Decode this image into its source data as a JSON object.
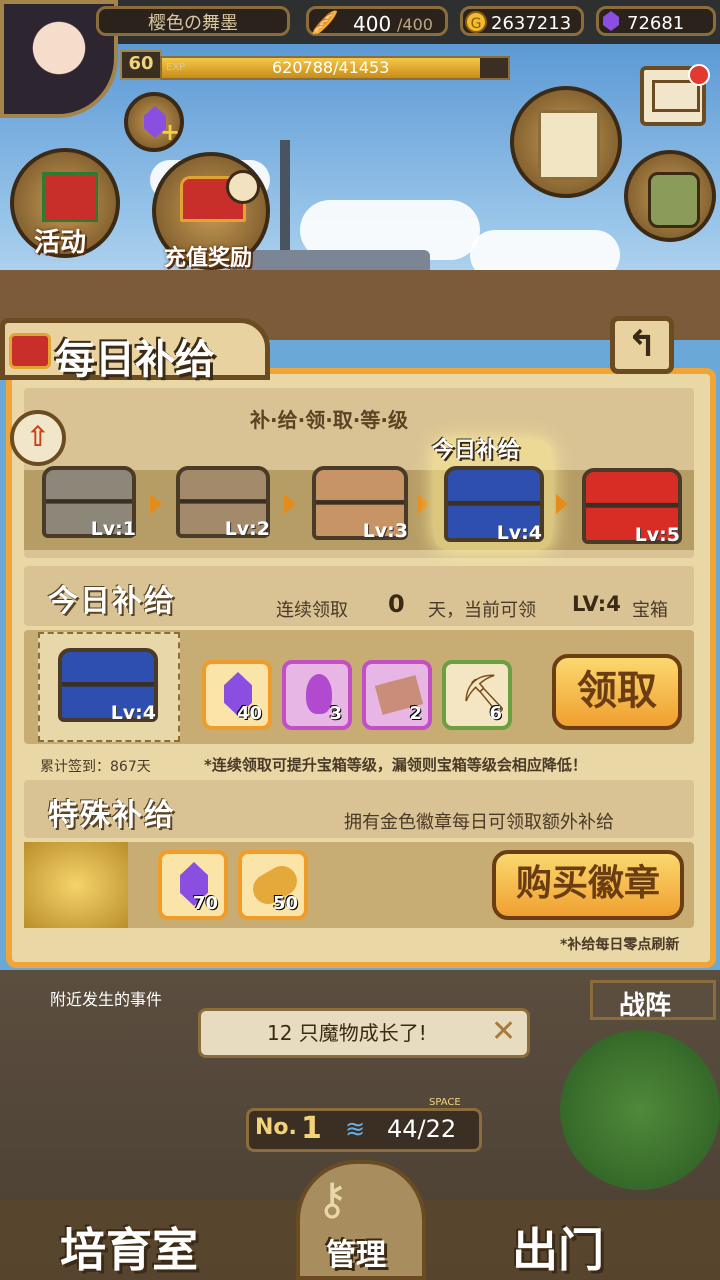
{
  "header": {
    "player_name": "樱色の舞墨",
    "stamina": "400",
    "stamina_max": "/400",
    "gold": "2637213",
    "gems": "72681",
    "level": "60",
    "exp_label": "EXP",
    "exp_text": "620788/41453",
    "exp_progress": 0.92
  },
  "side_buttons": {
    "event_label": "活动",
    "recharge_label": "充值奖励"
  },
  "panel": {
    "title": "每日补给",
    "tier_header": "补·给·领·取·等·级",
    "today_tag": "今日补给",
    "chests": [
      {
        "label": "Lv:1",
        "color": "#8d8779"
      },
      {
        "label": "Lv:2",
        "color": "#a28a6b"
      },
      {
        "label": "Lv:3",
        "color": "#c79466"
      },
      {
        "label": "Lv:4",
        "color": "#2f4fb0"
      },
      {
        "label": "Lv:5",
        "color": "#d72d24"
      }
    ],
    "today": {
      "title": "今日补给",
      "streak_prefix": "连续领取",
      "streak_days": "0",
      "streak_suffix": "天，当前可领",
      "level_text": "LV:4",
      "chest_word": "宝箱",
      "chest_label": "Lv:4",
      "items": [
        {
          "icon": "purple-gem-icon",
          "count": "40",
          "border": "#f09c2a"
        },
        {
          "icon": "potion-icon",
          "count": "3",
          "border": "#c44fc4"
        },
        {
          "icon": "ticket-icon",
          "count": "2",
          "border": "#c44fc4"
        },
        {
          "icon": "pickaxe-icon",
          "count": "6",
          "border": "#6aa040"
        }
      ],
      "claim_button": "领取",
      "total_signin": "累计签到：867天",
      "hint": "*连续领取可提升宝箱等级，漏领则宝箱等级会相应降低！"
    },
    "special": {
      "title": "特殊补给",
      "desc": "拥有金色徽章每日可领取额外补给",
      "items": [
        {
          "icon": "purple-gem-icon",
          "count": "70"
        },
        {
          "icon": "bread-icon",
          "count": "50"
        }
      ],
      "buy_button": "购买徽章",
      "refresh_note": "*补给每日零点刷新"
    }
  },
  "bottom": {
    "nearby_events": "附近发生的事件",
    "formation": "战阵",
    "notice": "12 只魔物成长了!",
    "rank_label": "No.",
    "rank": "1",
    "space_label": "SPACE",
    "space_value": "44/22",
    "nav_left": "培育室",
    "nav_center": "管理",
    "nav_right": "出门"
  }
}
